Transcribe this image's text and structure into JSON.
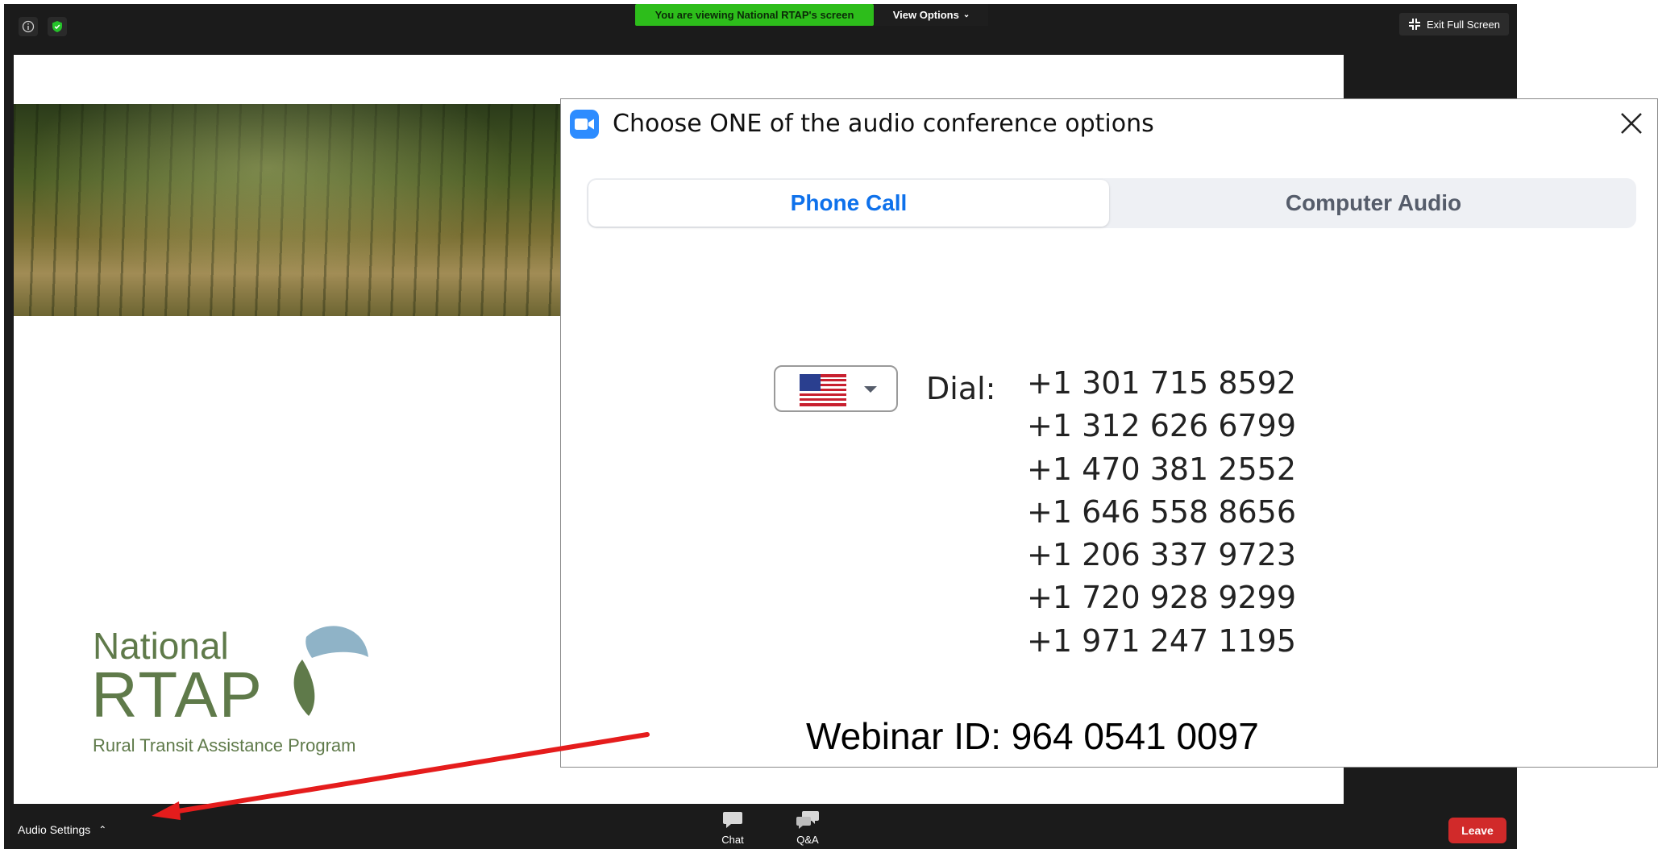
{
  "topbar": {
    "share_banner": "You are viewing National RTAP's screen",
    "view_options": "View Options",
    "exit_full_screen": "Exit Full Screen"
  },
  "slide": {
    "logo": {
      "line1": "National",
      "line2": "RTAP",
      "tagline": "Rural Transit Assistance Program"
    }
  },
  "dialog": {
    "title": "Choose ONE of the audio conference options",
    "tabs": [
      {
        "label": "Phone Call",
        "active": true
      },
      {
        "label": "Computer Audio",
        "active": false
      }
    ],
    "country": "United States",
    "dial_label": "Dial:",
    "numbers": [
      "+1 301 715 8592",
      "+1 312 626 6799",
      "+1 470 381 2552",
      "+1 646 558 8656",
      "+1 206 337 9723",
      "+1 720 928 9299",
      "+1 971 247 1195"
    ]
  },
  "webinar": {
    "label": "Webinar ID:",
    "id": "964 0541 0097",
    "full": "Webinar ID:  964 0541 0097"
  },
  "toolbar": {
    "audio_settings": "Audio Settings",
    "chat": "Chat",
    "qa": "Q&A",
    "leave": "Leave"
  },
  "colors": {
    "zoom_blue": "#0e71eb",
    "share_green": "#2dbd1b",
    "leave_red": "#d12a2a",
    "annotation_arrow": "#e51c1c"
  }
}
